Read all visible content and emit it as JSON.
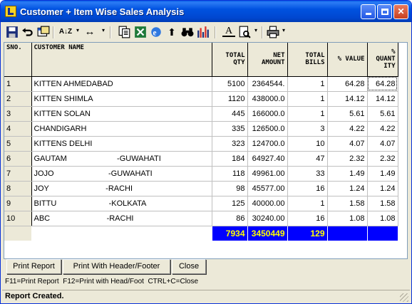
{
  "window": {
    "title": "Customer + Item Wise Sales Analysis",
    "minimize_icon": "minimize-icon",
    "maximize_icon": "maximize-icon",
    "close_icon": "close-icon",
    "close_glyph": "✕"
  },
  "toolbar": {
    "icons": [
      "save-icon",
      "undo-icon",
      "copy-window-icon",
      "sort-az-icon",
      "column-width-icon",
      "copy-icon",
      "excel-icon",
      "internet-explorer-icon",
      "up-arrow-icon",
      "find-icon",
      "bar-chart-icon",
      "font-icon",
      "print-preview-icon",
      "printer-icon"
    ],
    "sort_glyph": "A↓Z",
    "width_glyph": "↔",
    "font_glyph": "A",
    "up_glyph": "⬆"
  },
  "grid": {
    "headers": {
      "sno": "SNO.",
      "customer": "CUSTOMER NAME",
      "qty": "TOTAL QTY",
      "amount": "NET AMOUNT",
      "bills": "TOTAL BILLS",
      "value": "% VALUE",
      "quantity": "% QUANT ITY"
    },
    "rows": [
      {
        "sno": "1",
        "name": "KITTEN AHMEDABAD",
        "qty": "5100",
        "amount": "2364544.",
        "bills": "1",
        "value": "64.28",
        "quantity": "64.28"
      },
      {
        "sno": "2",
        "name": "KITTEN SHIMLA",
        "qty": "1120",
        "amount": "438000.0",
        "bills": "1",
        "value": "14.12",
        "quantity": "14.12"
      },
      {
        "sno": "3",
        "name": "KITTEN SOLAN",
        "qty": "445",
        "amount": "166000.0",
        "bills": "1",
        "value": "5.61",
        "quantity": "5.61"
      },
      {
        "sno": "4",
        "name": "CHANDIGARH",
        "qty": "335",
        "amount": "126500.0",
        "bills": "3",
        "value": "4.22",
        "quantity": "4.22"
      },
      {
        "sno": "5",
        "name": "KITTENS DELHI",
        "qty": "323",
        "amount": "124700.0",
        "bills": "10",
        "value": "4.07",
        "quantity": "4.07"
      },
      {
        "sno": "6",
        "name": "GAUTAM                       -GUWAHATI",
        "qty": "184",
        "amount": "64927.40",
        "bills": "47",
        "value": "2.32",
        "quantity": "2.32"
      },
      {
        "sno": "7",
        "name": "JOJO                         -GUWAHATI",
        "qty": "118",
        "amount": "49961.00",
        "bills": "33",
        "value": "1.49",
        "quantity": "1.49"
      },
      {
        "sno": "8",
        "name": "JOY                          -RACHI",
        "qty": "98",
        "amount": "45577.00",
        "bills": "16",
        "value": "1.24",
        "quantity": "1.24"
      },
      {
        "sno": "9",
        "name": "BITTU                        -KOLKATA",
        "qty": "125",
        "amount": "40000.00",
        "bills": "1",
        "value": "1.58",
        "quantity": "1.58"
      },
      {
        "sno": "10",
        "name": "ABC                          -RACHI",
        "qty": "86",
        "amount": "30240.00",
        "bills": "16",
        "value": "1.08",
        "quantity": "1.08"
      }
    ],
    "totals": {
      "qty": "7934",
      "amount": "3450449",
      "bills": "129"
    }
  },
  "buttons": {
    "print_report": "Print Report",
    "print_header_footer": "Print With Header/Footer",
    "close": "Close"
  },
  "hint": "F11=Print Report  F12=Print with Head/Foot  CTRL+C=Close",
  "status": "Report Created."
}
